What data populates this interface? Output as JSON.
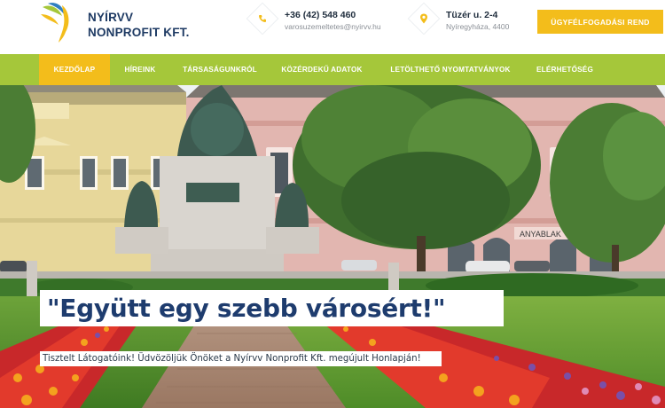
{
  "brand": {
    "name_line1": "NYÍRVV",
    "name_line2": "NONPROFIT KFT."
  },
  "contact": {
    "phone": {
      "icon": "phone-icon",
      "value": "+36 (42) 548 460",
      "email": "varosuzemeltetes@nyirvv.hu"
    },
    "address": {
      "icon": "location-pin-icon",
      "street": "Tüzér u. 2-4",
      "city": "Nyíregyháza, 4400"
    }
  },
  "cta": {
    "label": "ÜGYFÉLFOGADÁSI REND"
  },
  "nav": {
    "items": [
      {
        "label": "KEZDŐLAP",
        "active": true
      },
      {
        "label": "HÍREINK"
      },
      {
        "label": "TÁRSASÁGUNKRÓL"
      },
      {
        "label": "KÖZÉRDEKŰ ADATOK"
      },
      {
        "label": "LETÖLTHETŐ NYOMTATVÁNYOK"
      },
      {
        "label": "ELÉRHETŐSÉG"
      }
    ]
  },
  "hero": {
    "headline": "\"Együtt egy szebb városért!\"",
    "subline": "Tisztelt Látogatóink! Üdvözöljük Önöket a Nyírvv Nonprofit Kft. megújult Honlapján!",
    "shop_sign": "ANYABLAK"
  },
  "colors": {
    "accent_yellow": "#f3bd1b",
    "nav_green": "#a5c73a",
    "brand_navy": "#1e3a63"
  }
}
